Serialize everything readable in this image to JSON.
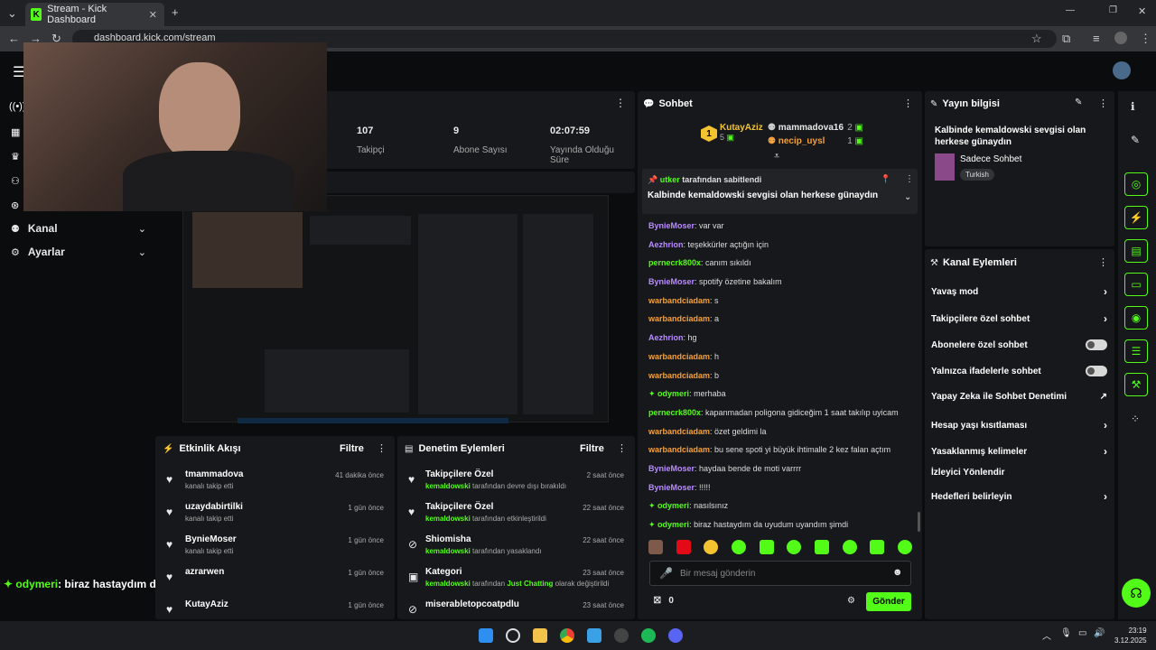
{
  "browser": {
    "tab_title": "Stream - Kick Dashboard",
    "url": "dashboard.kick.com/stream"
  },
  "nav": {
    "kanal": "Kanal",
    "ayarlar": "Ayarlar"
  },
  "stats": [
    {
      "value": "107",
      "label": "Takipçi"
    },
    {
      "value": "9",
      "label": "Abone Sayısı"
    },
    {
      "value": "02:07:59",
      "label": "Yayında Olduğu Süre"
    }
  ],
  "overlay_chat": {
    "user": "odymeri",
    "text": ": biraz hastaydım da uyudum uyandım şimdi"
  },
  "activity": {
    "title": "Etkinlik Akışı",
    "filter": "Filtre",
    "items": [
      {
        "name": "tmammadova",
        "sub": "kanalı takip etti",
        "time": "41 dakika önce"
      },
      {
        "name": "uzaydabirtilki",
        "sub": "kanalı takip etti",
        "time": "1 gün önce"
      },
      {
        "name": "BynieMoser",
        "sub": "kanalı takip etti",
        "time": "1 gün önce"
      },
      {
        "name": "azrarwen",
        "sub": "",
        "time": "1 gün önce"
      },
      {
        "name": "KutayAziz",
        "sub": "",
        "time": "1 gün önce"
      }
    ]
  },
  "moderation": {
    "title": "Denetim Eylemleri",
    "filter": "Filtre",
    "items": [
      {
        "name": "Takipçilere Özel",
        "user": "kemaldowski",
        "sub": "tarafından devre dışı bırakıldı",
        "time": "2 saat önce"
      },
      {
        "name": "Takipçilere Özel",
        "user": "kemaldowski",
        "sub": "tarafından etkinleştirildi",
        "time": "22 saat önce"
      },
      {
        "name": "Shiomisha",
        "user": "kemaldowski",
        "sub": "tarafından yasaklandı",
        "time": "22 saat önce"
      },
      {
        "name": "Kategori",
        "user": "kemaldowski",
        "sub": "tarafından",
        "cat": "Just Chatting",
        "sub2": "olarak değiştirildi",
        "time": "23 saat önce"
      },
      {
        "name": "miserabletopcoatpdlu",
        "user": "",
        "sub": "",
        "time": "23 saat önce"
      }
    ]
  },
  "chat": {
    "title": "Sohbet",
    "leaders": [
      {
        "rank": "1",
        "name": "KutayAziz",
        "count": "5"
      },
      {
        "name": "mammadova16",
        "count": "2"
      },
      {
        "name": "necip_uysl",
        "count": "1"
      }
    ],
    "pinned_by": "utker",
    "pinned_label": "tarafından sabitlendi",
    "pinned_text": "Kalbinde kemaldowski sevgisi olan herkese günaydın",
    "messages": [
      {
        "u": "BynieMoser",
        "c": "p",
        "t": ": var var"
      },
      {
        "u": "Aezhrion",
        "c": "p",
        "t": ": teşekkürler açtığın için"
      },
      {
        "u": "pernecrk800x",
        "c": "g",
        "t": ": canım sıkıldı"
      },
      {
        "u": "BynieMoser",
        "c": "p",
        "t": ": spotify özetine bakalım"
      },
      {
        "u": "warbandciadam",
        "c": "o",
        "t": ": s"
      },
      {
        "u": "warbandciadam",
        "c": "o",
        "t": ": a"
      },
      {
        "u": "Aezhrion",
        "c": "p",
        "t": ": hg"
      },
      {
        "u": "warbandciadam",
        "c": "o",
        "t": ": h"
      },
      {
        "u": "warbandciadam",
        "c": "o",
        "t": ": b"
      },
      {
        "u": "odymeri",
        "c": "g",
        "t": ": merhaba"
      },
      {
        "u": "pernecrk800x",
        "c": "g",
        "t": ": kapanmadan poligona gidiceğim 1 saat takılıp uyicam"
      },
      {
        "u": "warbandciadam",
        "c": "o",
        "t": ": özet geldimi la"
      },
      {
        "u": "warbandciadam",
        "c": "o",
        "t": ": bu sene spoti yi büyük ihtimalle 2 kez falan açtım"
      },
      {
        "u": "BynieMoser",
        "c": "p",
        "t": ": haydaa bende de moti varrrr"
      },
      {
        "u": "BynieMoser",
        "c": "p",
        "t": ": !!!!!"
      },
      {
        "u": "odymeri",
        "c": "g",
        "t": ": nasılsınız"
      },
      {
        "u": "odymeri",
        "c": "g",
        "t": ": biraz hastaydım da uyudum uyandım şimdi"
      }
    ],
    "placeholder": "Bir mesaj gönderin",
    "points": "0",
    "send": "Gönder"
  },
  "info": {
    "title": "Yayın bilgisi",
    "stream_title": "Kalbinde kemaldowski sevgisi olan herkese günaydın",
    "category": "Sadece Sohbet",
    "tag": "Turkish"
  },
  "actions": {
    "title": "Kanal Eylemleri",
    "items": [
      {
        "label": "Yavaş mod",
        "ctl": "arrow"
      },
      {
        "label": "Takipçilere özel sohbet",
        "ctl": "arrow"
      },
      {
        "label": "Abonelere özel sohbet",
        "ctl": "toggle"
      },
      {
        "label": "Yalnızca ifadelerle sohbet",
        "ctl": "toggle"
      },
      {
        "label": "Yapay Zeka ile Sohbet Denetimi",
        "ctl": "ext"
      },
      {
        "label": "Hesap yaşı kısıtlaması",
        "ctl": "arrow"
      },
      {
        "label": "Yasaklanmış kelimeler",
        "ctl": "arrow"
      },
      {
        "label": "İzleyici Yönlendir",
        "ctl": ""
      },
      {
        "label": "Hedefleri belirleyin",
        "ctl": "arrow"
      }
    ]
  },
  "taskbar": {
    "time": "23:19",
    "date": "3.12.2025"
  },
  "colors": {
    "accent": "#53fc18",
    "panel": "#17181b"
  }
}
